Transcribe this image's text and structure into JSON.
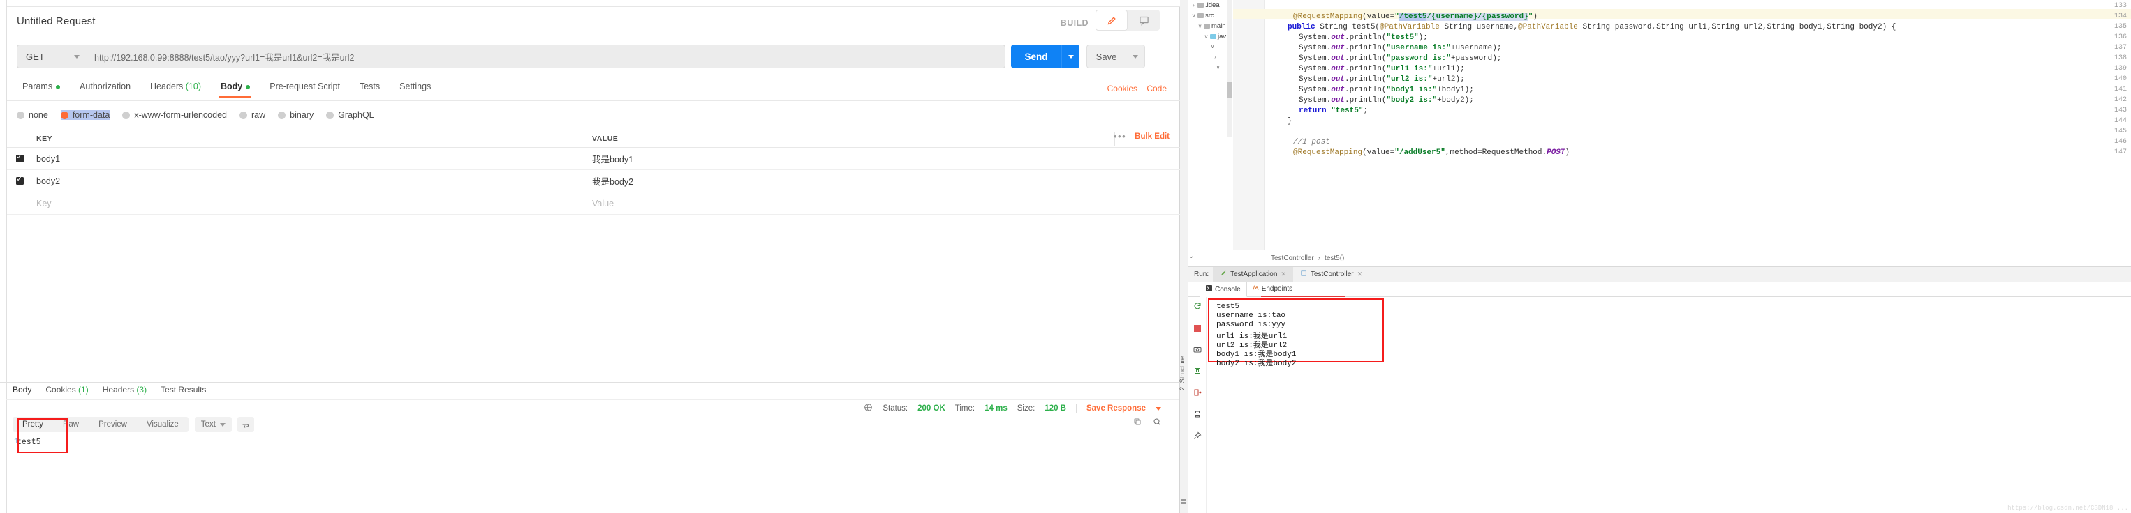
{
  "postman": {
    "title": "Untitled Request",
    "build_label": "BUILD",
    "edit_icon": "pencil-icon",
    "comment_icon": "comment-icon",
    "method": "GET",
    "url": "http://192.168.0.99:8888/test5/tao/yyy?url1=我是url1&url2=我是url2",
    "send_label": "Send",
    "save_label": "Save",
    "cookies_link": "Cookies",
    "code_link": "Code",
    "request_tabs": [
      {
        "label": "Params",
        "dot": true,
        "count": "",
        "active": false
      },
      {
        "label": "Authorization",
        "dot": false,
        "count": "",
        "active": false
      },
      {
        "label": "Headers",
        "dot": false,
        "count": "(10)",
        "active": false
      },
      {
        "label": "Body",
        "dot": true,
        "count": "",
        "active": true
      },
      {
        "label": "Pre-request Script",
        "dot": false,
        "count": "",
        "active": false
      },
      {
        "label": "Tests",
        "dot": false,
        "count": "",
        "active": false
      },
      {
        "label": "Settings",
        "dot": false,
        "count": "",
        "active": false
      }
    ],
    "body_types": [
      {
        "label": "none",
        "selected": false
      },
      {
        "label": "form-data",
        "selected": true
      },
      {
        "label": "x-www-form-urlencoded",
        "selected": false
      },
      {
        "label": "raw",
        "selected": false
      },
      {
        "label": "binary",
        "selected": false
      },
      {
        "label": "GraphQL",
        "selected": false
      }
    ],
    "table": {
      "headers": [
        "KEY",
        "VALUE"
      ],
      "bulk_edit": "Bulk Edit",
      "rows": [
        {
          "checked": true,
          "key": "body1",
          "value": "我是body1"
        },
        {
          "checked": true,
          "key": "body2",
          "value": "我是body2"
        }
      ],
      "placeholder_key": "Key",
      "placeholder_value": "Value"
    },
    "response": {
      "tabs": [
        {
          "label": "Body",
          "count": "",
          "active": true
        },
        {
          "label": "Cookies",
          "count": "(1)",
          "active": false
        },
        {
          "label": "Headers",
          "count": "(3)",
          "active": false
        },
        {
          "label": "Test Results",
          "count": "",
          "active": false
        }
      ],
      "status_label": "Status:",
      "status_value": "200 OK",
      "time_label": "Time:",
      "time_value": "14 ms",
      "size_label": "Size:",
      "size_value": "120 B",
      "save_response": "Save Response",
      "format_tabs": [
        "Pretty",
        "Raw",
        "Preview",
        "Visualize"
      ],
      "format_active": "Pretty",
      "content_type": "Text",
      "line_number": "1",
      "body_text": "test5"
    }
  },
  "ide": {
    "structure_label": "2: Structure",
    "tree": [
      {
        "label": ".idea",
        "depth": 0,
        "arrow": "›",
        "folder": "gray"
      },
      {
        "label": "src",
        "depth": 0,
        "arrow": "∨",
        "folder": "gray"
      },
      {
        "label": "main",
        "depth": 1,
        "arrow": "∨",
        "folder": "gray"
      },
      {
        "label": "jav",
        "depth": 2,
        "arrow": "∨",
        "folder": "blue"
      }
    ],
    "code_lines": [
      {
        "n": "133",
        "text": ""
      },
      {
        "n": "134",
        "text": "@RequestMapping(value=\"/test5/{username}/{password}\")"
      },
      {
        "n": "135",
        "text": "public String test5(@PathVariable String username,@PathVariable String password,String url1,String url2,String body1,String body2) {"
      },
      {
        "n": "136",
        "text": "System.out.println(\"test5\");"
      },
      {
        "n": "137",
        "text": "System.out.println(\"username is:\"+username);"
      },
      {
        "n": "138",
        "text": "System.out.println(\"password is:\"+password);"
      },
      {
        "n": "139",
        "text": "System.out.println(\"url1 is:\"+url1);"
      },
      {
        "n": "140",
        "text": "System.out.println(\"url2 is:\"+url2);"
      },
      {
        "n": "141",
        "text": "System.out.println(\"body1 is:\"+body1);"
      },
      {
        "n": "142",
        "text": "System.out.println(\"body2 is:\"+body2);"
      },
      {
        "n": "143",
        "text": "return \"test5\";"
      },
      {
        "n": "144",
        "text": "}"
      },
      {
        "n": "145",
        "text": ""
      },
      {
        "n": "146",
        "text": "//1 post"
      },
      {
        "n": "147",
        "text": "@RequestMapping(value=\"/addUser5\",method=RequestMethod.POST)"
      }
    ],
    "breadcrumb": [
      "TestController",
      "test5()"
    ],
    "run_label": "Run:",
    "run_tabs": [
      {
        "label": "TestApplication",
        "active": true
      },
      {
        "label": "TestController",
        "active": false
      }
    ],
    "console_tabs": [
      {
        "label": "Console",
        "active": true
      },
      {
        "label": "Endpoints",
        "active": false
      }
    ],
    "console_output": [
      "test5",
      "username is:tao",
      "password is:yyy",
      "url1 is:我是url1",
      "url2 is:我是url2",
      "body1 is:我是body1",
      "body2 is:我是body2"
    ],
    "watermark": "https://blog.csdn.net/CSDN18 ..."
  },
  "colors": {
    "accent": "#ff6c37",
    "send_blue": "#0f82f5",
    "green": "#2db04b",
    "annotation_red": "#f51c1c"
  }
}
